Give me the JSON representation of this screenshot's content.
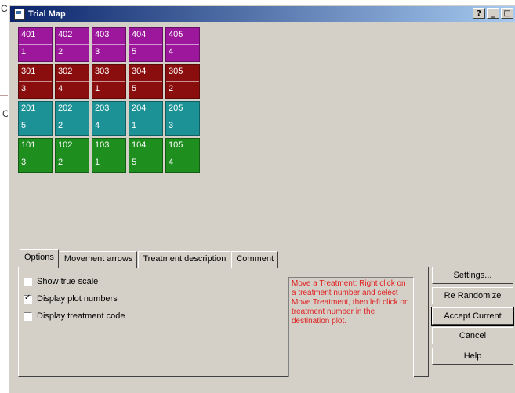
{
  "window": {
    "title": "Trial Map"
  },
  "title_buttons": [
    "?",
    "_",
    "□"
  ],
  "background_fragments": [
    "C",
    "C"
  ],
  "plot_rows": [
    {
      "color": "#9c179c",
      "plots": [
        {
          "plot": "401",
          "treatment": "1"
        },
        {
          "plot": "402",
          "treatment": "2"
        },
        {
          "plot": "403",
          "treatment": "3"
        },
        {
          "plot": "404",
          "treatment": "5"
        },
        {
          "plot": "405",
          "treatment": "4"
        }
      ]
    },
    {
      "color": "#8b0e0e",
      "plots": [
        {
          "plot": "301",
          "treatment": "3"
        },
        {
          "plot": "302",
          "treatment": "4"
        },
        {
          "plot": "303",
          "treatment": "1"
        },
        {
          "plot": "304",
          "treatment": "5"
        },
        {
          "plot": "305",
          "treatment": "2"
        }
      ]
    },
    {
      "color": "#1c9296",
      "plots": [
        {
          "plot": "201",
          "treatment": "5"
        },
        {
          "plot": "202",
          "treatment": "2"
        },
        {
          "plot": "203",
          "treatment": "4"
        },
        {
          "plot": "204",
          "treatment": "1"
        },
        {
          "plot": "205",
          "treatment": "3"
        }
      ]
    },
    {
      "color": "#1e8e1e",
      "plots": [
        {
          "plot": "101",
          "treatment": "3"
        },
        {
          "plot": "102",
          "treatment": "2"
        },
        {
          "plot": "103",
          "treatment": "1"
        },
        {
          "plot": "104",
          "treatment": "5"
        },
        {
          "plot": "105",
          "treatment": "4"
        }
      ]
    }
  ],
  "tabs": [
    "Options",
    "Movement arrows",
    "Treatment description",
    "Comment"
  ],
  "options": [
    {
      "label": "Show true scale",
      "checked": false
    },
    {
      "label": "Display plot numbers",
      "checked": true
    },
    {
      "label": "Display treatment code",
      "checked": false
    }
  ],
  "hint_text": "Move a Treatment: Right click on a treatment number and select Move Treatment, then left click on treatment number in the destination plot.",
  "buttons": {
    "settings": "Settings...",
    "rerandomize": "Re Randomize",
    "accept": "Accept Current",
    "cancel": "Cancel",
    "help": "Help"
  }
}
